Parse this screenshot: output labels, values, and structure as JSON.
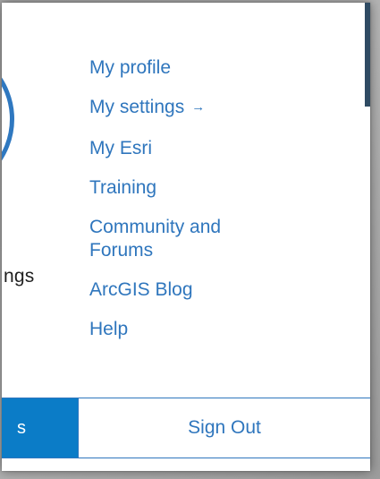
{
  "colors": {
    "link": "#2f76bd",
    "primary_button": "#0b7cc7",
    "avatar_ring": "#2f78c0",
    "header_strip": "#2f4b63",
    "backdrop": "#ababab"
  },
  "left_partial": {
    "label_fragment": "ngs",
    "avatar_ring_icon": "avatar-ring"
  },
  "menu": {
    "items": [
      {
        "label": "My profile"
      },
      {
        "label": "My settings",
        "icon": "arrow-right-icon",
        "icon_glyph": "→"
      },
      {
        "label": "My Esri"
      },
      {
        "label": "Training"
      },
      {
        "label": "Community and Forums"
      },
      {
        "label": "ArcGIS Blog"
      },
      {
        "label": "Help"
      }
    ]
  },
  "footer": {
    "left_button_fragment": "s",
    "sign_out_label": "Sign Out"
  }
}
